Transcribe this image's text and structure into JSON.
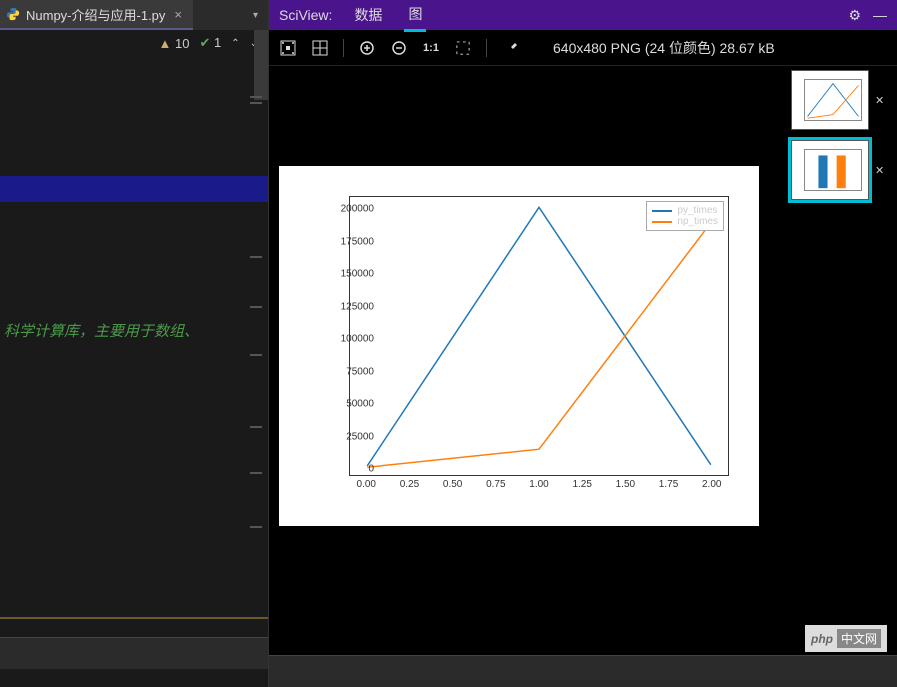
{
  "editor": {
    "tab_name": "Numpy-介绍与应用-1.py",
    "warn_count": "10",
    "check_count": "1",
    "code_line": "科学计算库，主要用于数组、"
  },
  "sciview": {
    "title": "SciView:",
    "tab_data": "数据",
    "tab_plot": "图",
    "image_info": "640x480 PNG (24 位颜色) 28.67 kB",
    "zoom_11": "1:1"
  },
  "legend": {
    "series1": "py_times",
    "series2": "np_times"
  },
  "watermark": {
    "brand": "php",
    "cn": "中文网"
  },
  "chart_data": {
    "type": "line",
    "x": [
      0.0,
      1.0,
      2.0
    ],
    "series": [
      {
        "name": "py_times",
        "values": [
          2000,
          202000,
          3000
        ],
        "color": "#1f77b4"
      },
      {
        "name": "np_times",
        "values": [
          1000,
          15000,
          190000
        ],
        "color": "#ff7f0e"
      }
    ],
    "x_ticks": [
      "0.00",
      "0.25",
      "0.50",
      "0.75",
      "1.00",
      "1.25",
      "1.50",
      "1.75",
      "2.00"
    ],
    "y_ticks": [
      "0",
      "25000",
      "50000",
      "75000",
      "100000",
      "125000",
      "150000",
      "175000",
      "200000"
    ],
    "xlim": [
      -0.1,
      2.1
    ],
    "ylim": [
      -5000,
      210000
    ]
  }
}
